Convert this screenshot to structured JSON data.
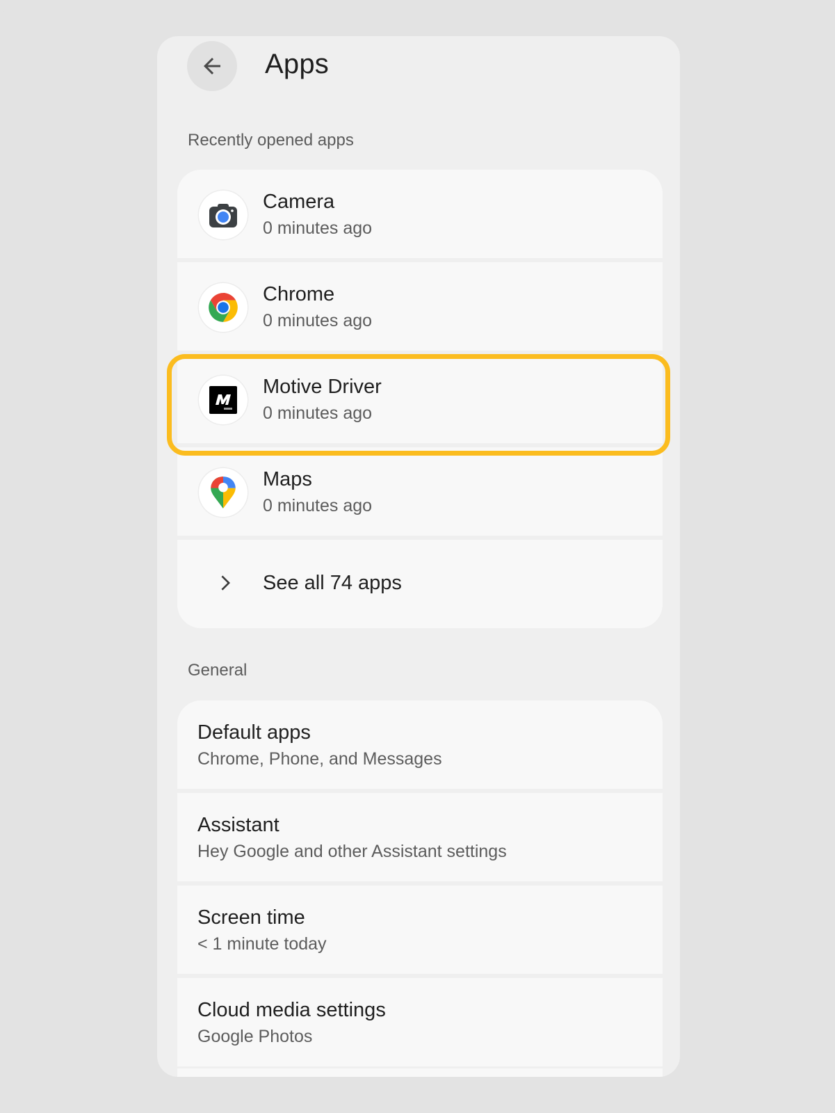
{
  "header": {
    "title": "Apps",
    "back_icon": "arrow-left-icon"
  },
  "recent": {
    "section_label": "Recently opened apps",
    "items": [
      {
        "name": "Camera",
        "subtitle": "0 minutes ago",
        "icon": "camera-app-icon"
      },
      {
        "name": "Chrome",
        "subtitle": "0 minutes ago",
        "icon": "chrome-app-icon"
      },
      {
        "name": "Motive Driver",
        "subtitle": "0 minutes ago",
        "icon": "motive-driver-app-icon",
        "highlighted": true
      },
      {
        "name": "Maps",
        "subtitle": "0 minutes ago",
        "icon": "maps-app-icon"
      }
    ],
    "see_all_label": "See all 74 apps",
    "see_all_icon": "chevron-right-icon"
  },
  "general": {
    "section_label": "General",
    "items": [
      {
        "title": "Default apps",
        "subtitle": "Chrome, Phone, and Messages"
      },
      {
        "title": "Assistant",
        "subtitle": "Hey Google and other Assistant settings"
      },
      {
        "title": "Screen time",
        "subtitle": "< 1 minute today"
      },
      {
        "title": "Cloud media settings",
        "subtitle": "Google Photos"
      }
    ]
  },
  "colors": {
    "background": "#e3e3e3",
    "surface": "#efefef",
    "card": "#f8f8f8",
    "highlight": "#fbbc1f",
    "text_primary": "#1f1f1f",
    "text_secondary": "#5c5c5c"
  }
}
